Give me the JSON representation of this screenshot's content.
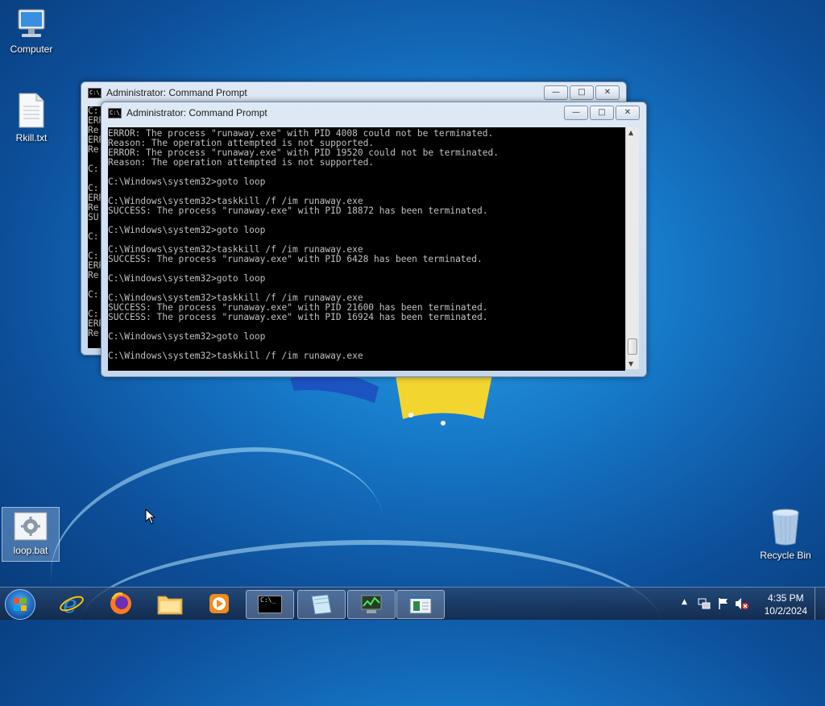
{
  "desktop": {
    "icons": {
      "computer": "Computer",
      "rkill": "Rkill.txt",
      "loop": "loop.bat",
      "recycle": "Recycle Bin"
    }
  },
  "back_window": {
    "title": "Administrator:  Command Prompt",
    "lines": [
      "C:",
      "ERR",
      "Re",
      "ERR",
      "Re",
      "",
      "C:",
      "",
      "C:",
      "ERR",
      "Re",
      "SU",
      "",
      "C:",
      "",
      "C:",
      "ERR",
      "Re",
      "",
      "C:",
      "",
      "C:",
      "ERR",
      "Re"
    ]
  },
  "front_window": {
    "title": "Administrator:  Command Prompt",
    "lines": [
      "ERROR: The process \"runaway.exe\" with PID 4008 could not be terminated.",
      "Reason: The operation attempted is not supported.",
      "ERROR: The process \"runaway.exe\" with PID 19520 could not be terminated.",
      "Reason: The operation attempted is not supported.",
      "",
      "C:\\Windows\\system32>goto loop",
      "",
      "C:\\Windows\\system32>taskkill /f /im runaway.exe",
      "SUCCESS: The process \"runaway.exe\" with PID 18872 has been terminated.",
      "",
      "C:\\Windows\\system32>goto loop",
      "",
      "C:\\Windows\\system32>taskkill /f /im runaway.exe",
      "SUCCESS: The process \"runaway.exe\" with PID 6428 has been terminated.",
      "",
      "C:\\Windows\\system32>goto loop",
      "",
      "C:\\Windows\\system32>taskkill /f /im runaway.exe",
      "SUCCESS: The process \"runaway.exe\" with PID 21600 has been terminated.",
      "SUCCESS: The process \"runaway.exe\" with PID 16924 has been terminated.",
      "",
      "C:\\Windows\\system32>goto loop",
      "",
      "C:\\Windows\\system32>taskkill /f /im runaway.exe"
    ]
  },
  "window_controls": {
    "minimize": "—",
    "maximize": "□",
    "close": "✕"
  },
  "taskbar": {
    "clock_time": "4:35 PM",
    "clock_date": "10/2/2024",
    "cmd_icon_text": "C:\\_"
  },
  "icons": {
    "start": "windows-start-icon",
    "ie": "internet-explorer-icon",
    "firefox": "firefox-icon",
    "explorer": "file-explorer-icon",
    "media": "media-player-icon",
    "cmd": "command-prompt-icon",
    "notepad": "notepad-icon",
    "taskmgr": "task-manager-icon",
    "app": "application-icon"
  },
  "colors": {
    "console_bg": "#000000",
    "console_text": "#c0c0c0",
    "desktop": "#1678c8"
  }
}
